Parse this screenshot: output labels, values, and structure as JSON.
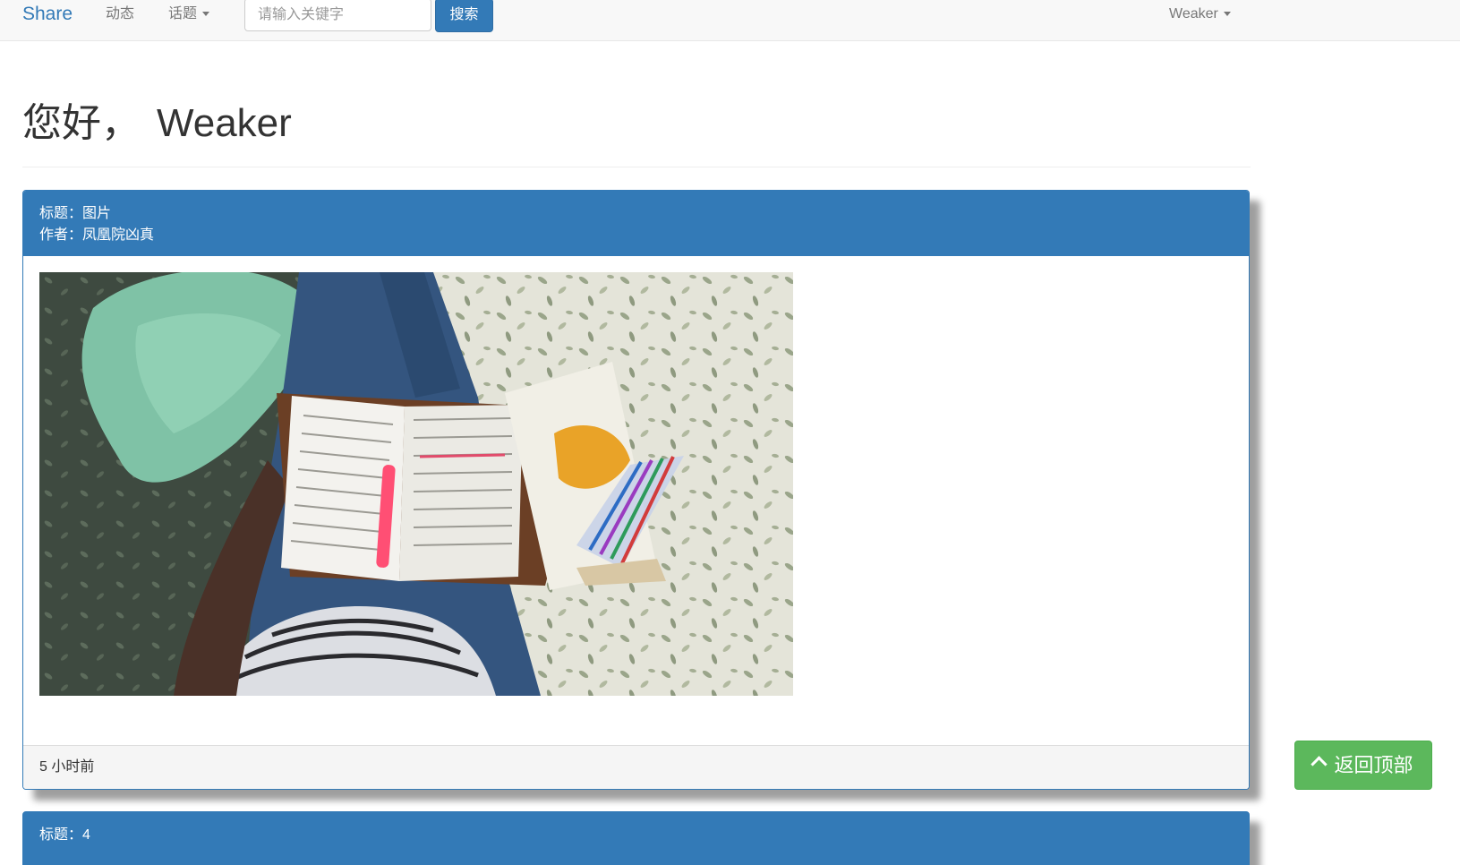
{
  "navbar": {
    "brand": "Share",
    "links": {
      "activity": "动态",
      "topics": "话题"
    },
    "search": {
      "placeholder": "请输入关键字",
      "value": "",
      "button_label": "搜索"
    },
    "user_menu": "Weaker"
  },
  "header": {
    "greeting": "您好，",
    "username": "Weaker"
  },
  "posts": [
    {
      "title_line": "标题：图片",
      "author_line": "作者：凤凰院凶真",
      "image_icon": "photo-reading-book-on-bed",
      "timestamp": "5 小时前"
    },
    {
      "title_line": "标题：4"
    }
  ],
  "back_to_top": {
    "label": "返回顶部",
    "icon": "chevron-up-icon"
  },
  "colors": {
    "primary": "#337ab7",
    "success": "#5cb85c",
    "navbar_bg": "#f8f8f8"
  }
}
